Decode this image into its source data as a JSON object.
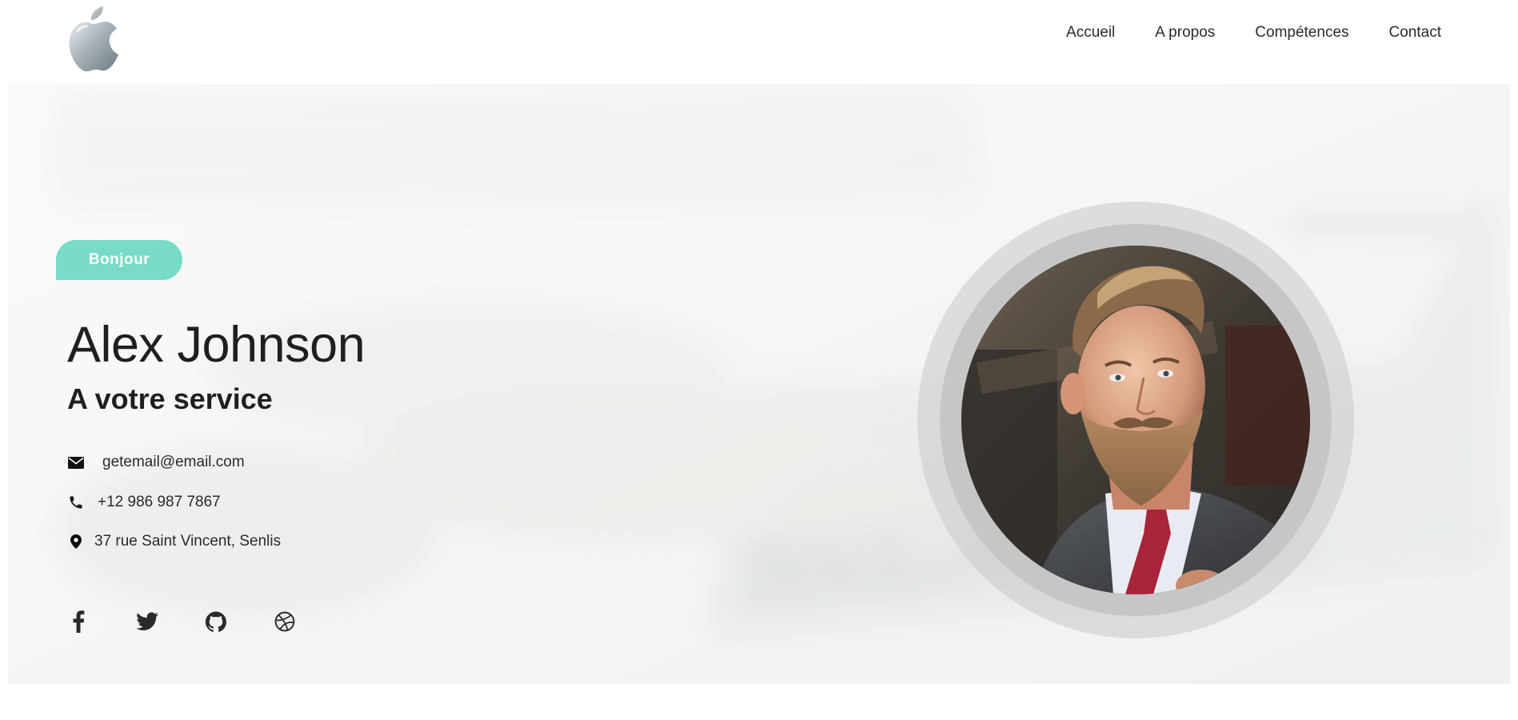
{
  "header": {
    "logo_icon": "apple-logo-icon",
    "nav": [
      {
        "label": "Accueil"
      },
      {
        "label": "A propos"
      },
      {
        "label": "Compétences"
      },
      {
        "label": "Contact"
      }
    ]
  },
  "hero": {
    "badge": "Bonjour",
    "name": "Alex Johnson",
    "tagline": "A votre service",
    "contacts": {
      "email": {
        "icon": "envelope-icon",
        "text": "getemail@email.com"
      },
      "phone": {
        "icon": "phone-icon",
        "text": "+12 986 987 7867"
      },
      "address": {
        "icon": "map-marker-icon",
        "text": "37 rue Saint Vincent, Senlis"
      }
    },
    "socials": [
      {
        "icon": "facebook-icon"
      },
      {
        "icon": "twitter-icon"
      },
      {
        "icon": "github-icon"
      },
      {
        "icon": "dribbble-icon"
      }
    ],
    "portrait_icon": "profile-photo",
    "colors": {
      "accent": "#77dbc5",
      "text": "#1f1f1f"
    }
  }
}
